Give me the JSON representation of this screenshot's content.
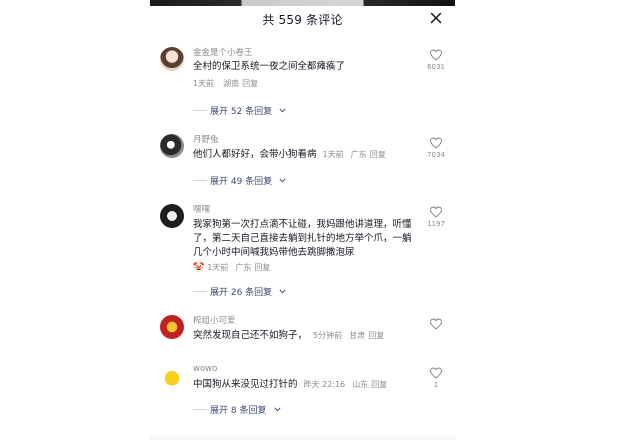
{
  "header": {
    "title": "共 559 条评论"
  },
  "comments": [
    {
      "user": "金金是个小卷王",
      "text": "全村的保卫系统一夜之间全都瘫痪了",
      "time": "1天前",
      "location": "湖南",
      "reply": "回复",
      "likes": "6031",
      "expand": "展开 52 条回复"
    },
    {
      "user": "月野兔",
      "text": "他们人都好好，会带小狗看病",
      "time": "1天前",
      "location": "广东",
      "reply": "回复",
      "likes": "7034",
      "expand": "展开 49 条回复"
    },
    {
      "user": "嘿嘿",
      "text": "我家狗第一次打点滴不让碰，我妈跟他讲道理，听懂了，第二天自己直接去躺到扎针的地方举个爪，一躺几个小时中间喊我妈带他去跳脚撒泡尿",
      "time": "1天前",
      "location": "广东",
      "reply": "回复",
      "likes": "1197",
      "expand": "展开 26 条回复"
    },
    {
      "user": "榨组小可爱",
      "text": "突然发现自己还不如狗子，",
      "time": "5分钟前",
      "location": "甘肃",
      "reply": "回复",
      "likes": "",
      "expand": ""
    },
    {
      "user": "wowo",
      "text": "中国狗从来没见过打针的",
      "time": "昨天 22:16",
      "location": "山东",
      "reply": "回复",
      "likes": "1",
      "expand": "展开 8 条回复"
    }
  ],
  "icons": {
    "close": "close-icon",
    "like": "heart-outline-icon",
    "expand": "chevron-down-icon"
  },
  "colors": {
    "text": "#161823",
    "meta": "#8a8b91",
    "link": "#3d4a77"
  }
}
